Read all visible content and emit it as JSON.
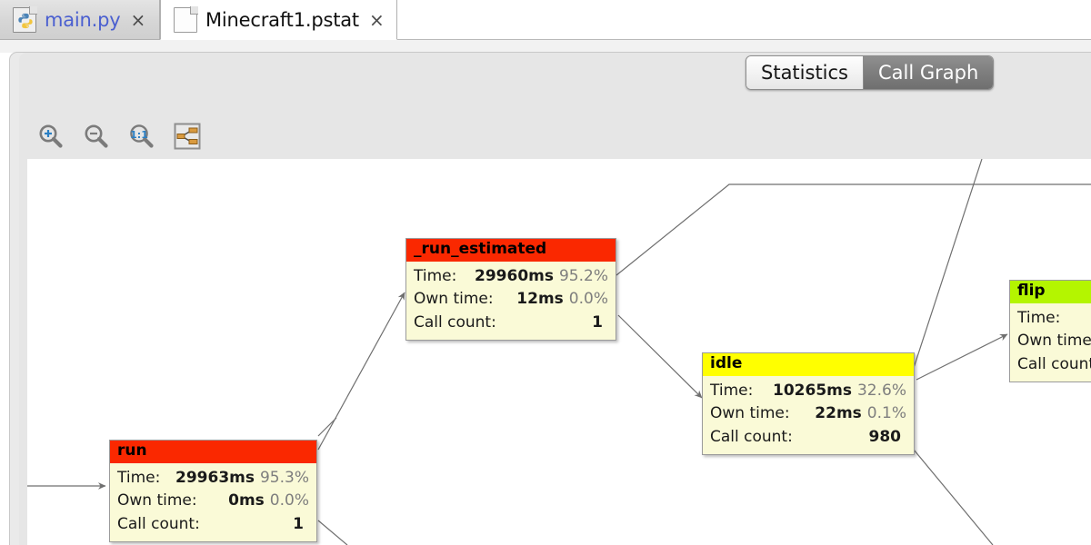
{
  "window": {
    "tabs": [
      {
        "label": "main.py",
        "icon": "python-file-icon",
        "active": false,
        "close_glyph": "×"
      },
      {
        "label": "Minecraft1.pstat",
        "icon": "generic-file-icon",
        "active": true,
        "close_glyph": "×"
      }
    ]
  },
  "view_switch": {
    "options": [
      {
        "label": "Statistics",
        "selected": false
      },
      {
        "label": "Call Graph",
        "selected": true
      }
    ]
  },
  "toolbar": {
    "buttons": [
      {
        "name": "zoom-in-icon",
        "tooltip": "Zoom in"
      },
      {
        "name": "zoom-out-icon",
        "tooltip": "Zoom out"
      },
      {
        "name": "zoom-actual-size-icon",
        "label": "1:1",
        "tooltip": "Actual size"
      },
      {
        "name": "fit-graph-icon",
        "tooltip": "Fit graph"
      }
    ]
  },
  "graph": {
    "labels": {
      "time": "Time:",
      "own_time": "Own time:",
      "call_count": "Call count:"
    },
    "colors": {
      "header_red": "#fa2800",
      "header_yellow": "#ffff00",
      "header_green": "#b4f500",
      "node_body": "#fafad7",
      "edge": "#6f6f6f",
      "canvas": "#ffffff"
    },
    "nodes": [
      {
        "id": "run_estimated",
        "title": "_run_estimated",
        "header_color": "#fa2800",
        "time": "29960ms",
        "time_pct": "95.2%",
        "own_time": "12ms",
        "own_time_pct": "0.0%",
        "call_count": "1"
      },
      {
        "id": "idle",
        "title": "idle",
        "header_color": "#ffff00",
        "time": "10265ms",
        "time_pct": "32.6%",
        "own_time": "22ms",
        "own_time_pct": "0.1%",
        "call_count": "980"
      },
      {
        "id": "run",
        "title": "run",
        "header_color": "#fa2800",
        "time": "29963ms",
        "time_pct": "95.3%",
        "own_time": "0ms",
        "own_time_pct": "0.0%",
        "call_count": "1"
      },
      {
        "id": "flip",
        "title": "flip",
        "header_color": "#b4f500",
        "time": "",
        "time_pct": "",
        "own_time": "",
        "own_time_pct": "",
        "call_count": ""
      }
    ]
  }
}
